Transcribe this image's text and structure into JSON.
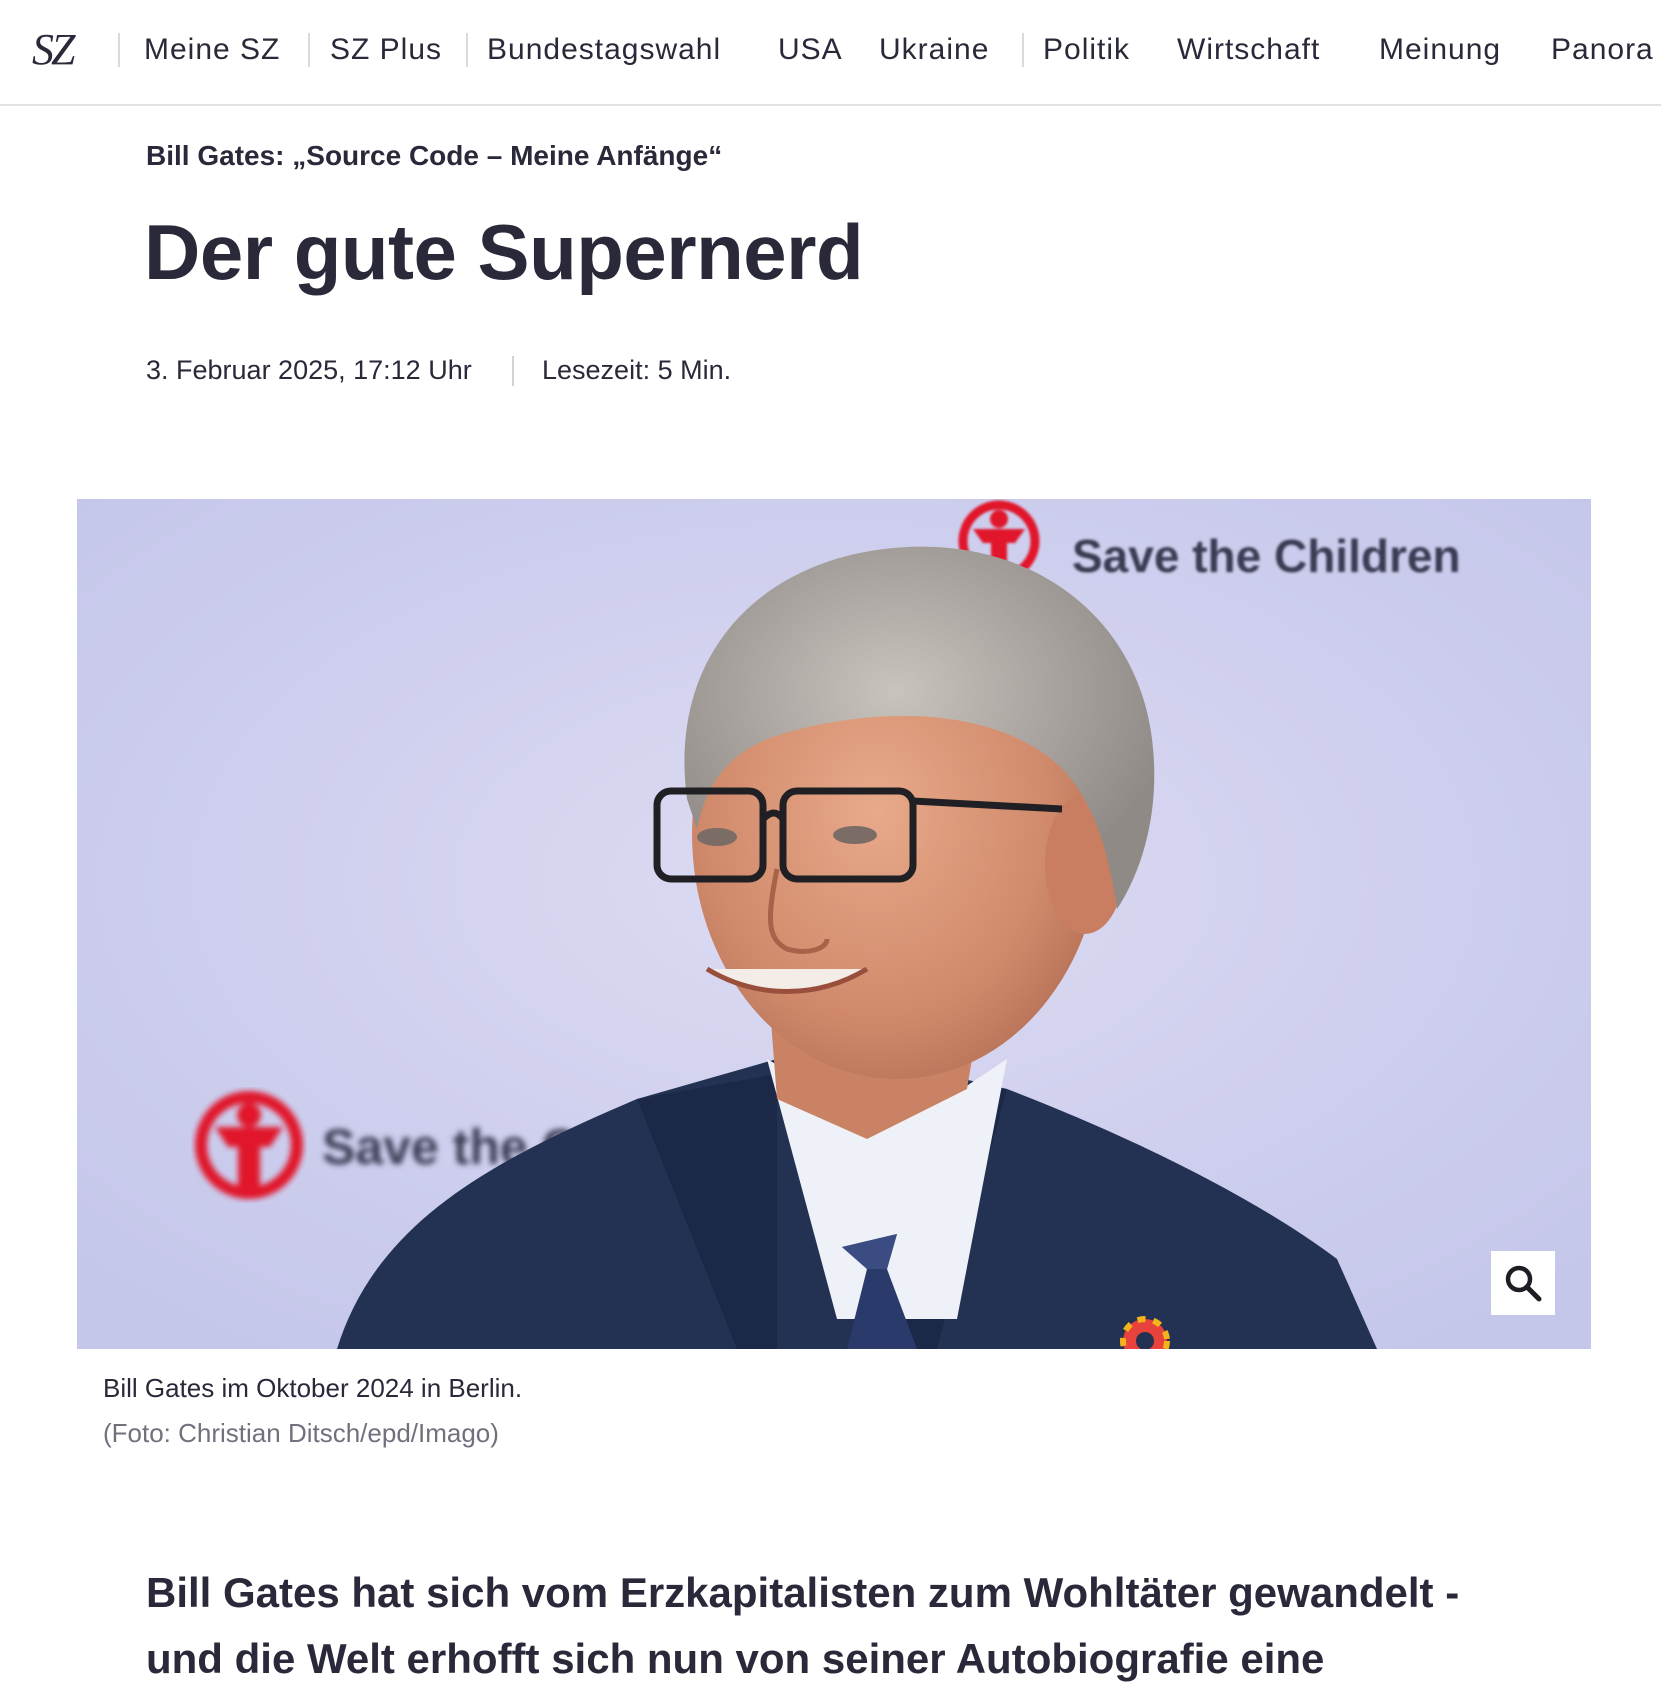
{
  "nav": {
    "logo": "SZ",
    "items": [
      "Meine SZ",
      "SZ Plus",
      "Bundestagswahl",
      "USA",
      "Ukraine",
      "Politik",
      "Wirtschaft",
      "Meinung",
      "Panora"
    ]
  },
  "article": {
    "overline": "Bill Gates: „Source Code – Meine Anfänge“",
    "headline": "Der gute Supernerd",
    "date": "3. Februar 2025, 17:12 Uhr",
    "reading_time": "Lesezeit: 5 Min.",
    "image": {
      "backdrop_text": "Save the Children",
      "backdrop_text_partial": "Save the Child",
      "caption": "Bill Gates im Oktober 2024 in Berlin.",
      "credit": "(Foto: Christian Ditsch/epd/Imago)",
      "zoom_icon": "search-icon"
    },
    "teaser": "Bill Gates hat sich vom Erzkapitalisten zum Wohltäter gewandelt - und die Welt erhofft sich nun von seiner Autobiografie eine"
  },
  "colors": {
    "text": "#29293a",
    "muted": "#71717e",
    "brand_red": "#e1152b",
    "backdrop": "#cfd0ee"
  }
}
